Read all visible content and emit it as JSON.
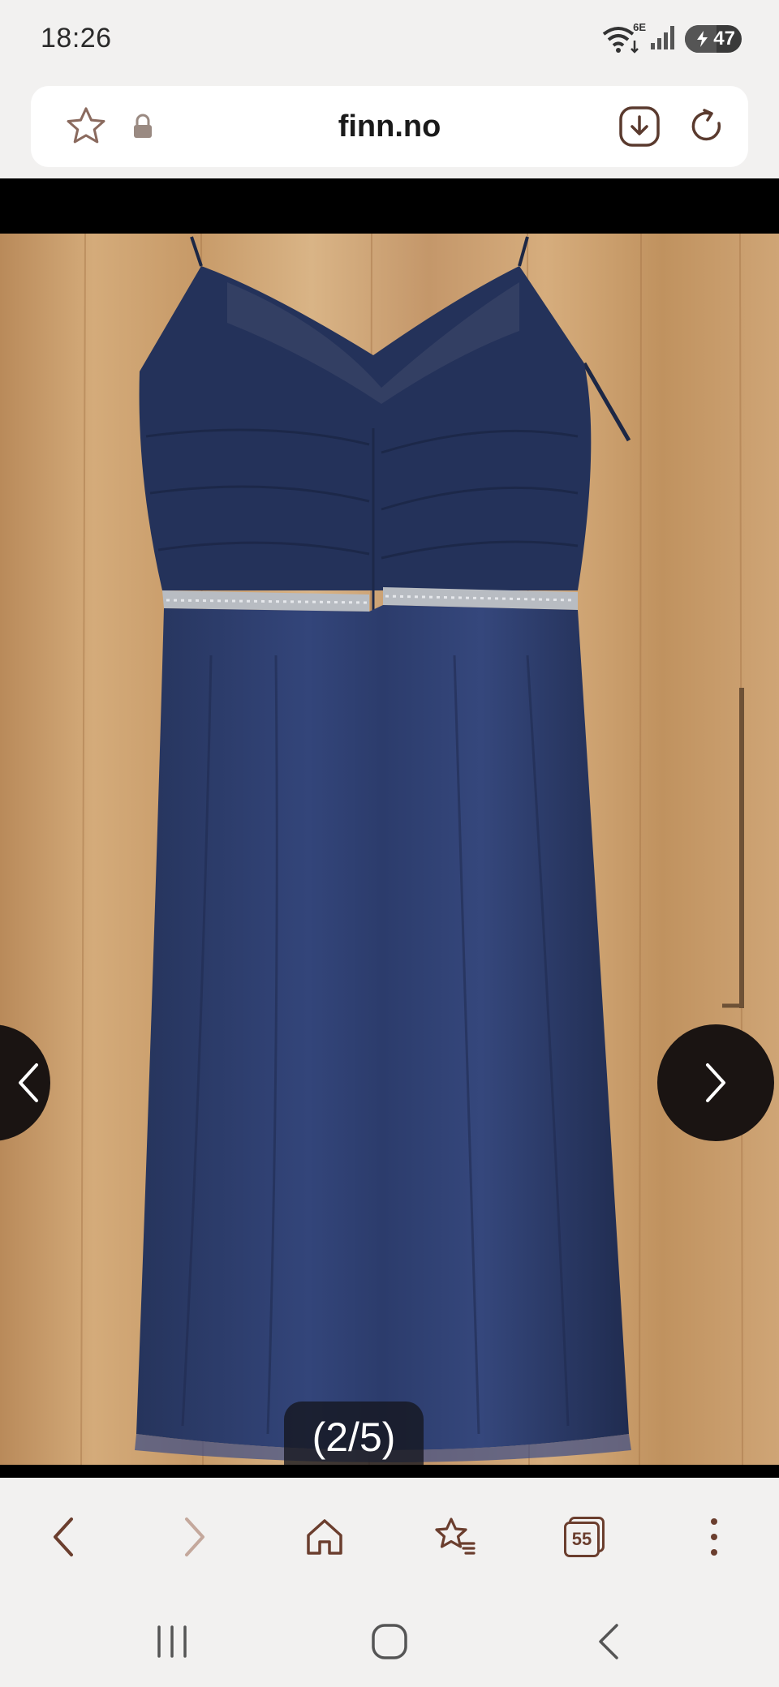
{
  "status_bar": {
    "time": "18:26",
    "network_label": "6E",
    "battery_level": "47",
    "icons": [
      "wifi-icon",
      "signal-icon",
      "battery-icon"
    ]
  },
  "address_bar": {
    "url": "finn.no",
    "icons": [
      "star-icon",
      "lock-icon",
      "download-icon",
      "reload-icon"
    ]
  },
  "gallery": {
    "counter": "(2/5)",
    "prev_icon": "chevron-left-icon",
    "next_icon": "chevron-right-icon"
  },
  "toolbar": {
    "tabs_count": "55",
    "icons": [
      "back-icon",
      "forward-icon",
      "home-icon",
      "bookmarks-icon",
      "tabs-icon",
      "menu-icon"
    ],
    "accent_color": "#7a4a38"
  },
  "system_nav": {
    "icons": [
      "recents-icon",
      "home-circle-icon",
      "back-triangle-icon"
    ]
  }
}
